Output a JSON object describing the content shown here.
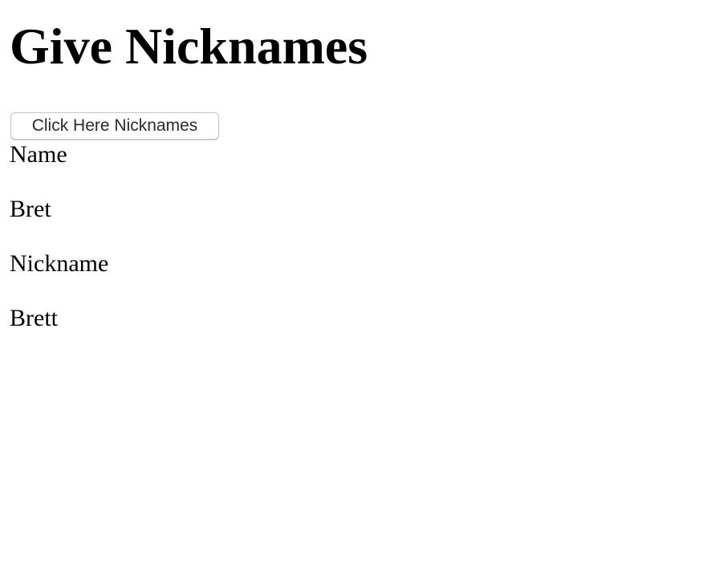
{
  "page": {
    "title": "Give Nicknames",
    "button_label": "Click Here Nicknames"
  },
  "fields": {
    "name_label": "Name",
    "name_value": "Bret",
    "nickname_label": "Nickname",
    "nickname_value": "Brett"
  },
  "colors": {
    "text": "#000000",
    "button_text": "#2b2b2b",
    "button_border": "#c4c4c4",
    "background": "#ffffff"
  }
}
